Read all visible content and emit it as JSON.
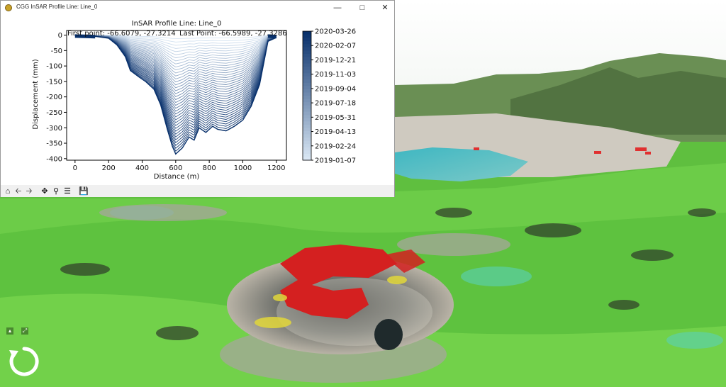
{
  "window": {
    "title": "CGG InSAR Profile Line: Line_0"
  },
  "chart": {
    "title": "InSAR Profile Line: Line_0",
    "first_point_label": "First point: -66.6079, -27.3214",
    "last_point_label": "Last Point: -66.5989, -27.3286",
    "xlabel": "Distance (m)",
    "ylabel": "Displacement (mm)",
    "colorbar_labels": [
      "2020-03-26",
      "2020-02-07",
      "2019-12-21",
      "2019-11-03",
      "2019-09-04",
      "2019-07-18",
      "2019-05-31",
      "2019-04-13",
      "2019-02-24",
      "2019-01-07"
    ]
  },
  "chart_data": {
    "type": "line",
    "title": "InSAR Profile Line: Line_0",
    "xlabel": "Distance (m)",
    "ylabel": "Displacement (mm)",
    "xlim": [
      -50,
      1260
    ],
    "ylim": [
      -405,
      15
    ],
    "x_ticks": [
      0,
      200,
      400,
      600,
      800,
      1000,
      1200
    ],
    "y_ticks": [
      0,
      -50,
      -100,
      -150,
      -200,
      -250,
      -300,
      -350,
      -400
    ],
    "x": [
      0,
      120,
      200,
      250,
      300,
      330,
      380,
      420,
      470,
      510,
      550,
      580,
      600,
      640,
      680,
      710,
      740,
      780,
      820,
      850,
      900,
      950,
      1000,
      1050,
      1100,
      1150,
      1200
    ],
    "final_profile": [
      -2,
      -4,
      -10,
      -32,
      -70,
      -115,
      -135,
      -150,
      -175,
      -225,
      -305,
      -360,
      -385,
      -365,
      -330,
      -340,
      -300,
      -315,
      -295,
      -305,
      -310,
      -295,
      -275,
      -230,
      -160,
      -20,
      -8
    ],
    "num_epochs": 40,
    "colormap": "Blues",
    "colorbar_ticks": [
      "2020-03-26",
      "2020-02-07",
      "2019-12-21",
      "2019-11-03",
      "2019-09-04",
      "2019-07-18",
      "2019-05-31",
      "2019-04-13",
      "2019-02-24",
      "2019-01-07"
    ],
    "grid": false
  },
  "toolbar": {
    "home_icon": "home-icon",
    "back_icon": "arrow-left-icon",
    "forward_icon": "arrow-right-icon",
    "pan_icon": "move-icon",
    "zoom_icon": "magnifier-icon",
    "config_icon": "sliders-icon",
    "save_icon": "save-icon"
  },
  "colors": {
    "curve_dark": "#08306b",
    "curve_light": "#deebf7"
  }
}
